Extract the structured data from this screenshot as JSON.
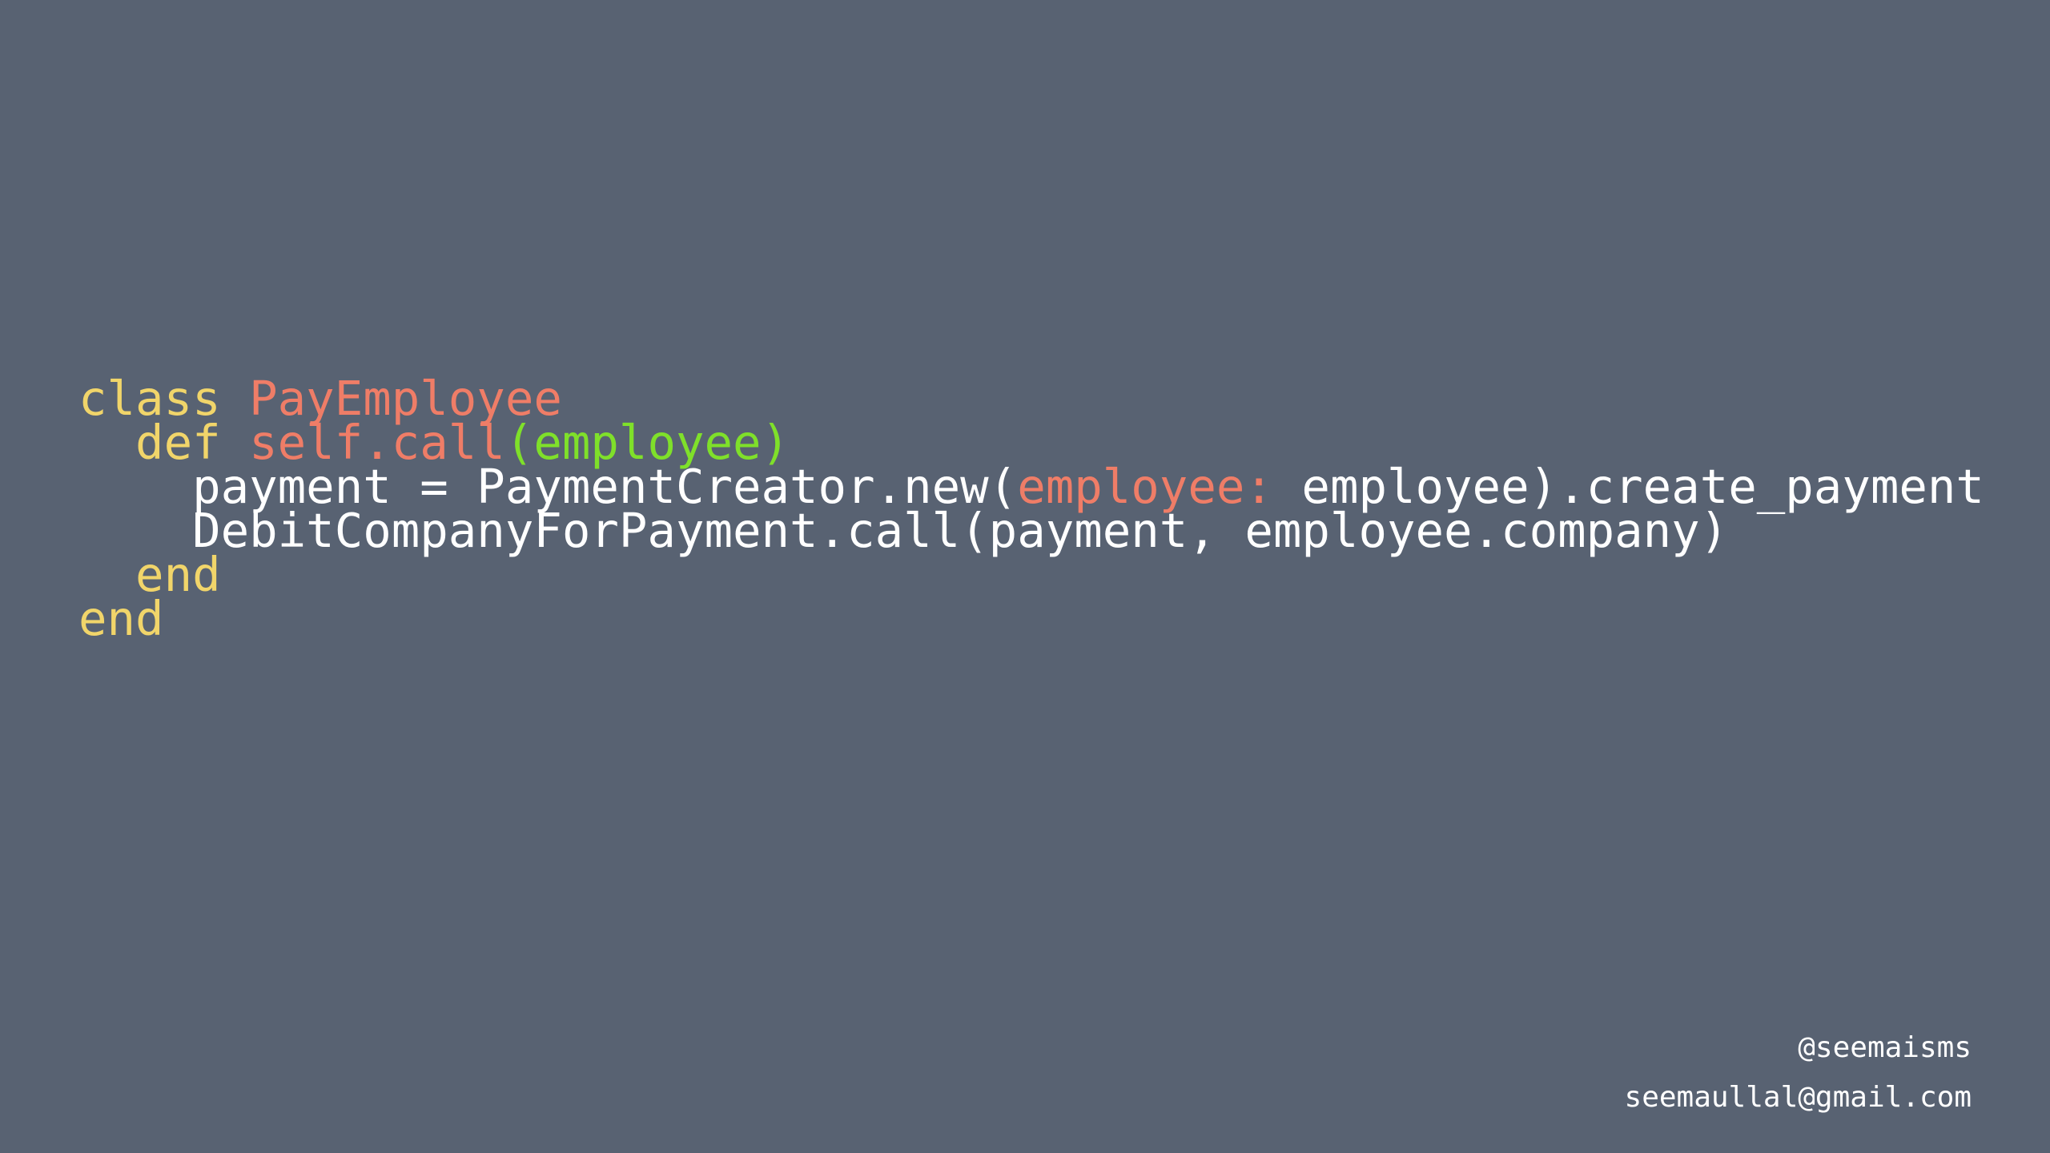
{
  "code_lines": [
    [
      {
        "text": "class ",
        "kind": "keyword"
      },
      {
        "text": "PayEmployee",
        "kind": "constant"
      }
    ],
    [
      {
        "text": "  def ",
        "kind": "keyword"
      },
      {
        "text": "self.call",
        "kind": "constant"
      },
      {
        "text": "(employee)",
        "kind": "parameter"
      }
    ],
    [
      {
        "text": "    payment = PaymentCreator.new(",
        "kind": "plain"
      },
      {
        "text": "employee:",
        "kind": "constant"
      },
      {
        "text": " employee).create_payment",
        "kind": "plain"
      }
    ],
    [
      {
        "text": "    DebitCompanyForPayment.call(payment, employee.company)",
        "kind": "plain"
      }
    ],
    [
      {
        "text": "  end",
        "kind": "keyword"
      }
    ],
    [
      {
        "text": "end",
        "kind": "keyword"
      }
    ]
  ],
  "footer": {
    "handle": "@seemaisms",
    "email": "seemaullal@gmail.com"
  },
  "colors": {
    "background": "#586272",
    "keyword": "#f1d56a",
    "constant": "#ef7d67",
    "parameter": "#7fe02a",
    "text": "#ffffff"
  }
}
